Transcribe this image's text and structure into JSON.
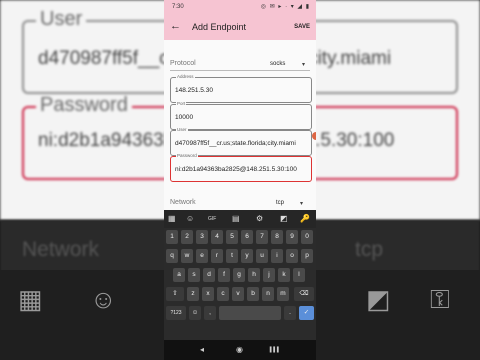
{
  "background": {
    "user_label": "User",
    "user_value": "d470987ff5f__cr.us;state.florida;city.miami",
    "password_label": "Password",
    "password_value": "ni:d2b1a94363ba2825@148.251.5.30:100",
    "network_label": "Network",
    "network_value": "tcp"
  },
  "status_bar": {
    "time": "7:30",
    "icons": "◎ ✉ ▸ · ▾ ◢ ▮"
  },
  "app_bar": {
    "back_icon": "←",
    "title": "Add Endpoint",
    "save_label": "SAVE"
  },
  "form": {
    "protocol_label": "Protocol",
    "protocol_value": "socks",
    "address_label": "Address",
    "address_value": "148.251.5.30",
    "port_label": "Port",
    "port_value": "10000",
    "user_label": "User",
    "user_value": "d470987ff5f__cr.us;state.florida;city.miami",
    "password_label": "Password",
    "password_value": "ni:d2b1a94363ba2825@148.251.5.30:100",
    "network_label": "Network",
    "network_value": "tcp"
  },
  "keyboard": {
    "toolbar": [
      "▦",
      "☺",
      "GIF",
      "▤",
      "⚙",
      "◩",
      "🔑"
    ],
    "row1": [
      "1",
      "2",
      "3",
      "4",
      "5",
      "6",
      "7",
      "8",
      "9",
      "0"
    ],
    "row2": [
      "q",
      "w",
      "e",
      "r",
      "t",
      "y",
      "u",
      "i",
      "o",
      "p"
    ],
    "row3": [
      "a",
      "s",
      "d",
      "f",
      "g",
      "h",
      "j",
      "k",
      "l"
    ],
    "row4": [
      "⇧",
      "z",
      "x",
      "c",
      "v",
      "b",
      "n",
      "m",
      "⌫"
    ],
    "row5": [
      "?123",
      "☺",
      ",",
      "",
      ".",
      "✓"
    ]
  },
  "navigation": {
    "back": "◂",
    "home": "◉",
    "recents": "▐▐▐"
  }
}
